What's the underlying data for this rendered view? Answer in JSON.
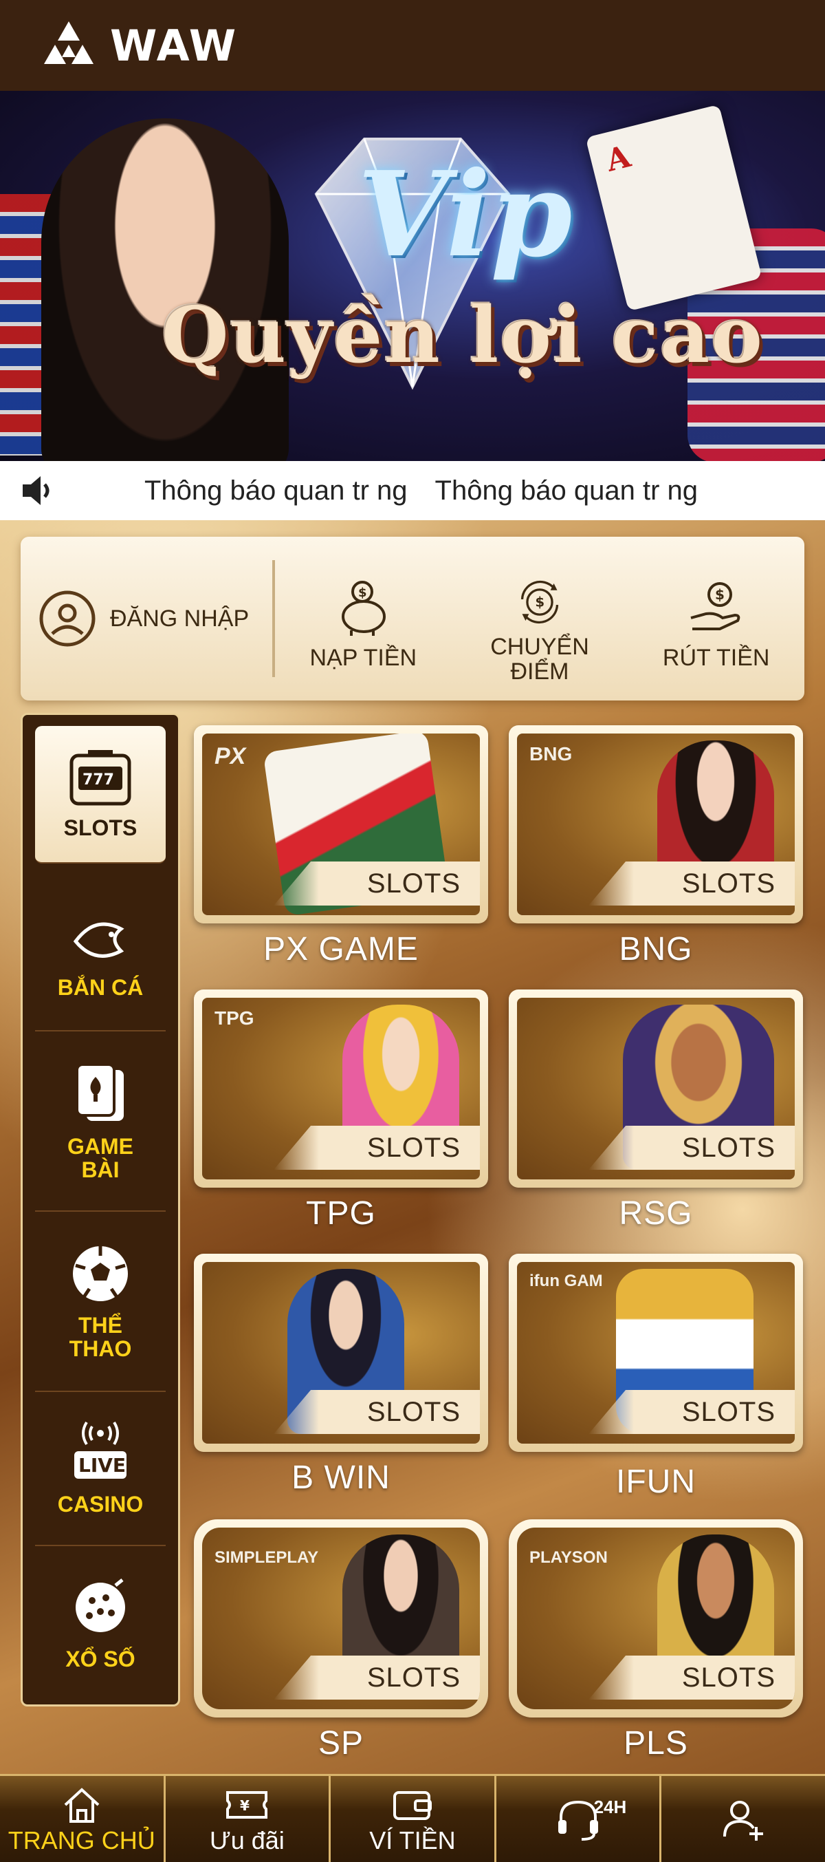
{
  "header": {
    "brand": "WAW"
  },
  "banner": {
    "headline": "Vip",
    "slogan": "Quyền lợi cao",
    "card_rank": "A"
  },
  "marquee": {
    "items": [
      "Thông báo quan tr   ng",
      "Thông báo quan tr   ng"
    ]
  },
  "actions": {
    "login_label": "ĐĂNG NHẬP",
    "deposit_label": "NẠP TIỀN",
    "transfer_label": "CHUYỂN ĐIỂM",
    "withdraw_label": "RÚT TIỀN"
  },
  "categories": [
    {
      "label": "SLOTS",
      "icon": "slot-machine-icon",
      "active": true
    },
    {
      "label": "BẮN CÁ",
      "icon": "fish-icon",
      "active": false
    },
    {
      "label": "GAME BÀI",
      "icon": "cards-icon",
      "active": false
    },
    {
      "label": "THỂ THAO",
      "icon": "soccer-ball-icon",
      "active": false
    },
    {
      "label": "CASINO",
      "icon": "live-icon",
      "badge": "LIVE",
      "active": false
    },
    {
      "label": "XỔ SỐ",
      "icon": "lottery-icon",
      "active": false
    }
  ],
  "games": [
    {
      "name": "PX GAME",
      "provider": "PX",
      "tag": "SLOTS"
    },
    {
      "name": "BNG",
      "provider": "BNG",
      "tag": "SLOTS"
    },
    {
      "name": "TPG",
      "provider": "TPG",
      "tag": "SLOTS"
    },
    {
      "name": "RSG",
      "provider": "",
      "tag": "SLOTS"
    },
    {
      "name": "B WIN",
      "provider": "",
      "tag": "SLOTS"
    },
    {
      "name": "IFUN",
      "provider": "ifun GAM",
      "tag": "SLOTS"
    },
    {
      "name": "SP",
      "provider": "SIMPLEPLAY",
      "tag": "SLOTS"
    },
    {
      "name": "PLS",
      "provider": "PLAYSON",
      "tag": "SLOTS"
    }
  ],
  "bottom_nav": [
    {
      "label": "TRANG CHỦ",
      "icon": "home-icon",
      "active": true
    },
    {
      "label": "Ưu đãi",
      "icon": "ticket-icon",
      "active": false
    },
    {
      "label": "VÍ TIỀN",
      "icon": "wallet-icon",
      "active": false
    },
    {
      "label": "",
      "icon": "headset-icon",
      "badge": "24H",
      "active": false
    },
    {
      "label": "",
      "icon": "add-user-icon",
      "active": false
    }
  ],
  "colors": {
    "accent_yellow": "#ffd21a",
    "brown_dark": "#3a200b",
    "cream": "#f7e8cd"
  }
}
